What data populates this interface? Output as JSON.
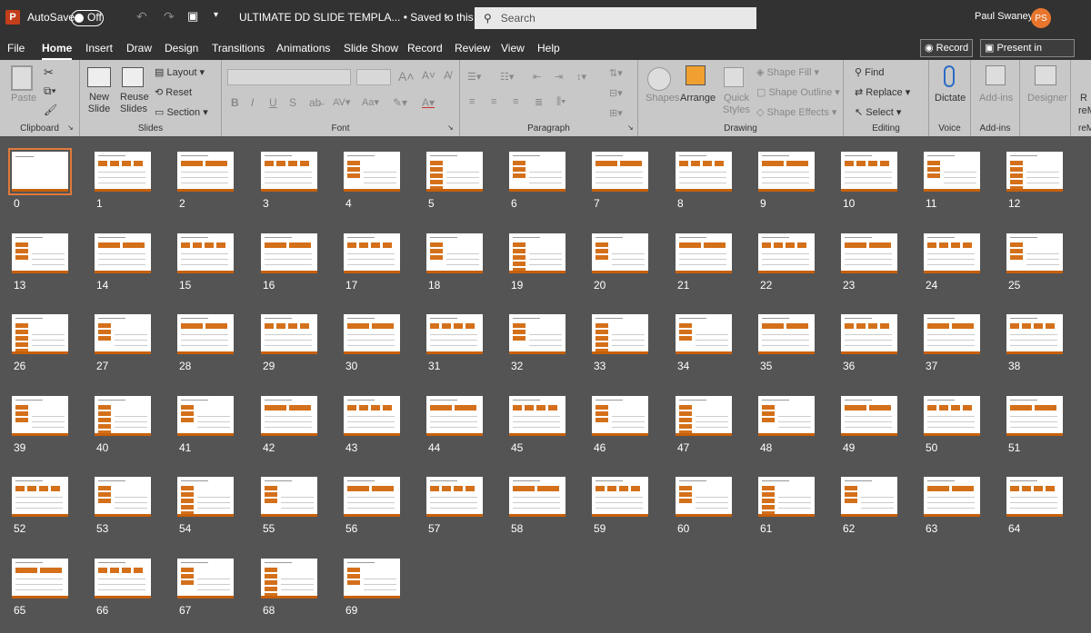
{
  "titlebar": {
    "autosave_label": "AutoSave",
    "autosave_state": "Off",
    "doc_title": "ULTIMATE DD SLIDE TEMPLA... • Saved to this PC",
    "search_placeholder": "Search",
    "user_name": "Paul Swaney",
    "user_initials": "PS"
  },
  "menu": {
    "tabs": [
      "File",
      "Home",
      "Insert",
      "Draw",
      "Design",
      "Transitions",
      "Animations",
      "Slide Show",
      "Record",
      "Review",
      "View",
      "Help"
    ],
    "active": "Home",
    "record_button": "Record",
    "present_button": "Present in Teams"
  },
  "ribbon": {
    "clipboard": {
      "label": "Clipboard",
      "paste": "Paste"
    },
    "slides": {
      "label": "Slides",
      "new_slide": "New Slide",
      "reuse": "Reuse Slides",
      "layout": "Layout",
      "reset": "Reset",
      "section": "Section"
    },
    "font": {
      "label": "Font"
    },
    "paragraph": {
      "label": "Paragraph"
    },
    "drawing": {
      "label": "Drawing",
      "shapes": "Shapes",
      "arrange": "Arrange",
      "quick_styles": "Quick Styles",
      "shape_fill": "Shape Fill",
      "shape_outline": "Shape Outline",
      "shape_effects": "Shape Effects"
    },
    "editing": {
      "label": "Editing",
      "find": "Find",
      "replace": "Replace",
      "select": "Select"
    },
    "voice": {
      "label": "Voice",
      "dictate": "Dictate"
    },
    "addins": {
      "label": "Add-ins",
      "addins": "Add-ins"
    },
    "designer": {
      "designer": "Designer"
    },
    "extra": {
      "label": "reM",
      "label_top": "R",
      "label_mid": "reM"
    }
  },
  "slides": [
    "0",
    "1",
    "2",
    "3",
    "4",
    "5",
    "6",
    "7",
    "8",
    "9",
    "10",
    "11",
    "12",
    "13",
    "14",
    "15",
    "16",
    "17",
    "18",
    "19",
    "20",
    "21",
    "22",
    "23",
    "24",
    "25",
    "26",
    "27",
    "28",
    "29",
    "30",
    "31",
    "32",
    "33",
    "34",
    "35",
    "36",
    "37",
    "38",
    "39",
    "40",
    "41",
    "42",
    "43",
    "44",
    "45",
    "46",
    "47",
    "48",
    "49",
    "50",
    "51",
    "52",
    "53",
    "54",
    "55",
    "56",
    "57",
    "58",
    "59",
    "60",
    "61",
    "62",
    "63",
    "64",
    "65",
    "66",
    "67",
    "68",
    "69"
  ],
  "selected_slide": "0",
  "colors": {
    "accent": "#c8600a",
    "chrome": "#323232",
    "ribbon": "#c8c8c8",
    "canvas": "#545454"
  }
}
